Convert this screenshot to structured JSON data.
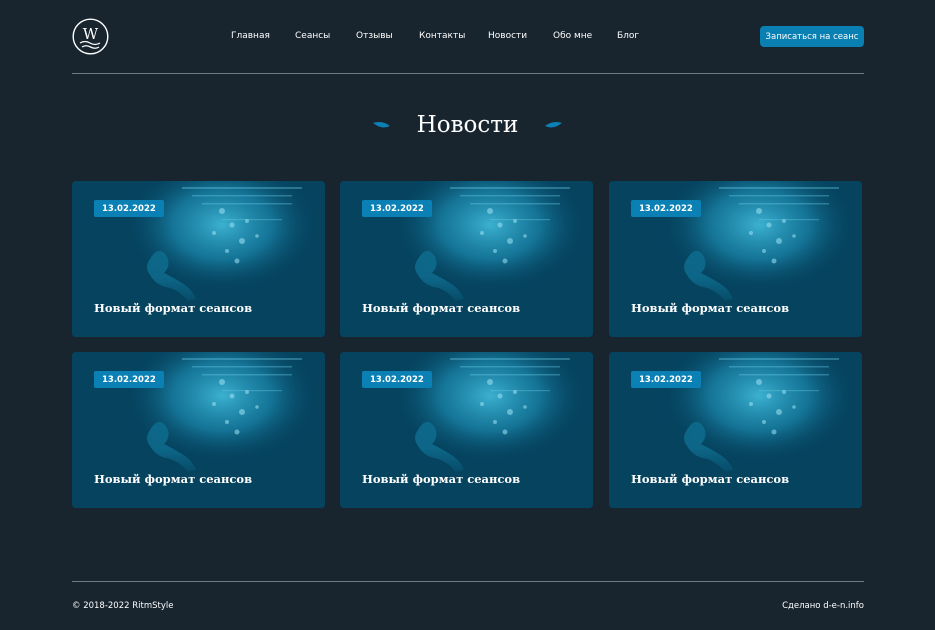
{
  "header": {
    "logo_letter": "W",
    "nav": [
      "Главная",
      "Сеансы",
      "Отзывы",
      "Контакты",
      "Новости",
      "Обо мне",
      "Блог"
    ],
    "cta_label": "Записаться на сеанс"
  },
  "page_title": "Новости",
  "news": [
    {
      "date": "13.02.2022",
      "title": "Новый формат сеансов"
    },
    {
      "date": "13.02.2022",
      "title": "Новый формат сеансов"
    },
    {
      "date": "13.02.2022",
      "title": "Новый формат сеансов"
    },
    {
      "date": "13.02.2022",
      "title": "Новый формат сеансов"
    },
    {
      "date": "13.02.2022",
      "title": "Новый формат сеансов"
    },
    {
      "date": "13.02.2022",
      "title": "Новый формат сеансов"
    }
  ],
  "footer": {
    "copyright": "© 2018-2022 RitmStyle",
    "made_by": "Сделано d-e-n.info"
  },
  "colors": {
    "background": "#18252f",
    "card": "#05435f",
    "accent": "#0a7fb2"
  }
}
